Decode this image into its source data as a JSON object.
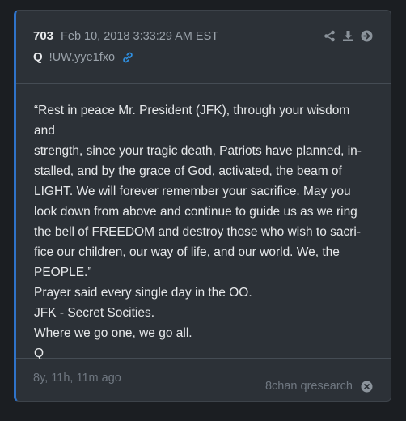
{
  "post": {
    "number": "703",
    "date": "Feb 10, 2018 3:33:29 AM EST",
    "author": "Q",
    "tripcode": "!UW.yye1fxo"
  },
  "body": {
    "lines": [
      "“Rest in peace Mr. President (JFK), through your wisdom and",
      "strength, since your tragic death, Patriots have planned, in-",
      "stalled, and by the grace of God, activated, the beam of",
      "LIGHT. We will forever remember your sacrifice. May you",
      "look down from above and continue to guide us as we ring",
      "the bell of FREEDOM and destroy those who wish to sacri-",
      "fice our children, our way of life, and our world. We, the",
      "PEOPLE.”",
      "Prayer said every single day in the OO.",
      "JFK - Secret Socities.",
      "Where we go one, we go all.",
      "Q"
    ]
  },
  "footer": {
    "age": "8y, 11h, 11m ago",
    "source": "8chan qresearch"
  },
  "icons": {
    "link": "link-icon",
    "share": "share-icon",
    "download": "download-icon",
    "go": "arrow-right-circle-icon",
    "close": "close-circle-icon"
  },
  "colors": {
    "accent": "#2f73c9",
    "card": "#2c3137",
    "background": "#1b1e22"
  }
}
